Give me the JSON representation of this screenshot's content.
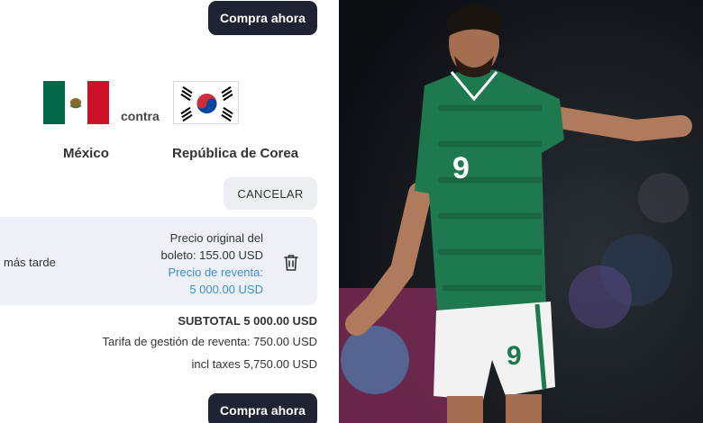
{
  "buy_button_label": "Compra ahora",
  "match": {
    "home": {
      "name": "México",
      "flag_icon": "mexico-flag"
    },
    "versus": "contra",
    "away": {
      "name": "República de Corea",
      "flag_icon": "south-korea-flag"
    }
  },
  "cancel_label": "CANCELAR",
  "ticket": {
    "left_text": "más tarde",
    "original_price_line1": "Precio original del",
    "original_price_line2": "boleto: 155.00 USD",
    "resale_label": "Precio de reventa:",
    "resale_value": "5 000.00 USD",
    "delete_icon": "trash-icon"
  },
  "totals": {
    "subtotal": "SUBTOTAL 5 000.00 USD",
    "fee": "Tarifa de gestión de reventa: 750.00 USD",
    "taxes": "incl taxes 5,750.00 USD"
  },
  "photo": {
    "jersey_number": "9",
    "colors": {
      "jersey": "#1e7a4e",
      "shorts": "#f2f2f2",
      "background": "#0f1417"
    }
  }
}
